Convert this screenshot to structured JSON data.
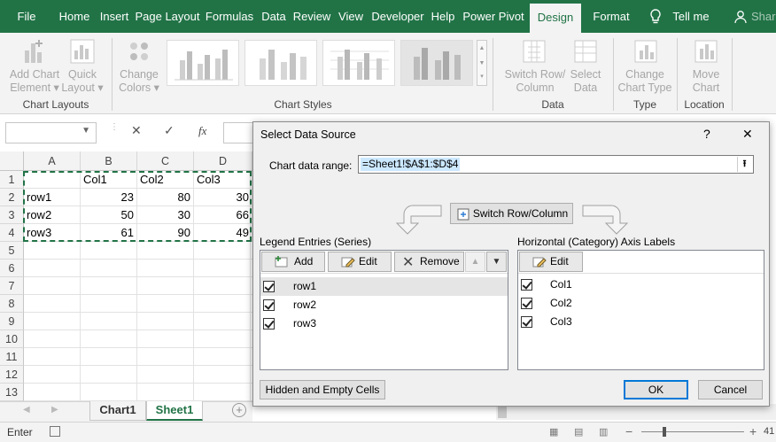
{
  "ribbon_tabs": [
    "File",
    "Home",
    "Insert",
    "Page Layout",
    "Formulas",
    "Data",
    "Review",
    "View",
    "Developer",
    "Help",
    "Power Pivot",
    "Design",
    "Format"
  ],
  "tell_me": "Tell me",
  "share": "Share",
  "ribbon": {
    "add_chart_element": [
      "Add Chart",
      "Element"
    ],
    "quick_layout": [
      "Quick",
      "Layout"
    ],
    "change_colors": [
      "Change",
      "Colors"
    ],
    "switch_row_column": [
      "Switch Row/",
      "Column"
    ],
    "select_data": [
      "Select",
      "Data"
    ],
    "change_chart_type": [
      "Change",
      "Chart Type"
    ],
    "move_chart": [
      "Move",
      "Chart"
    ],
    "group_chart_layouts": "Chart Layouts",
    "group_chart_styles": "Chart Styles",
    "group_data": "Data",
    "group_type": "Type",
    "group_location": "Location"
  },
  "formula_bar": {
    "fx": "fx",
    "cancel": "✕",
    "enter": "✓"
  },
  "columns": [
    "A",
    "B",
    "C",
    "D"
  ],
  "rows": [
    "1",
    "2",
    "3",
    "4",
    "5",
    "6",
    "7",
    "8",
    "9",
    "10",
    "11",
    "12",
    "13"
  ],
  "table": {
    "header": [
      "",
      "Col1",
      "Col2",
      "Col3"
    ],
    "data": [
      [
        "row1",
        "23",
        "80",
        "30"
      ],
      [
        "row2",
        "50",
        "30",
        "66"
      ],
      [
        "row3",
        "61",
        "90",
        "49"
      ]
    ]
  },
  "sheets": [
    "Chart1",
    "Sheet1"
  ],
  "status": "Enter",
  "zoom_fragment": "41",
  "dialog": {
    "title": "Select Data Source",
    "help": "?",
    "close": "✕",
    "range_label": "Chart data range:",
    "range_value": "=Sheet1!$A$1:$D$4",
    "switch_label": "Switch Row/Column",
    "legend_title": "Legend Entries (Series)",
    "add": "Add",
    "edit": "Edit",
    "remove": "Remove",
    "axis_title": "Horizontal (Category) Axis Labels",
    "axis_edit": "Edit",
    "series": [
      "row1",
      "row2",
      "row3"
    ],
    "categories": [
      "Col1",
      "Col2",
      "Col3"
    ],
    "hidden_empty": "Hidden and Empty Cells",
    "ok": "OK",
    "cancel": "Cancel"
  },
  "colors": {
    "accent": "#217346",
    "selection": "#cce8ff"
  }
}
